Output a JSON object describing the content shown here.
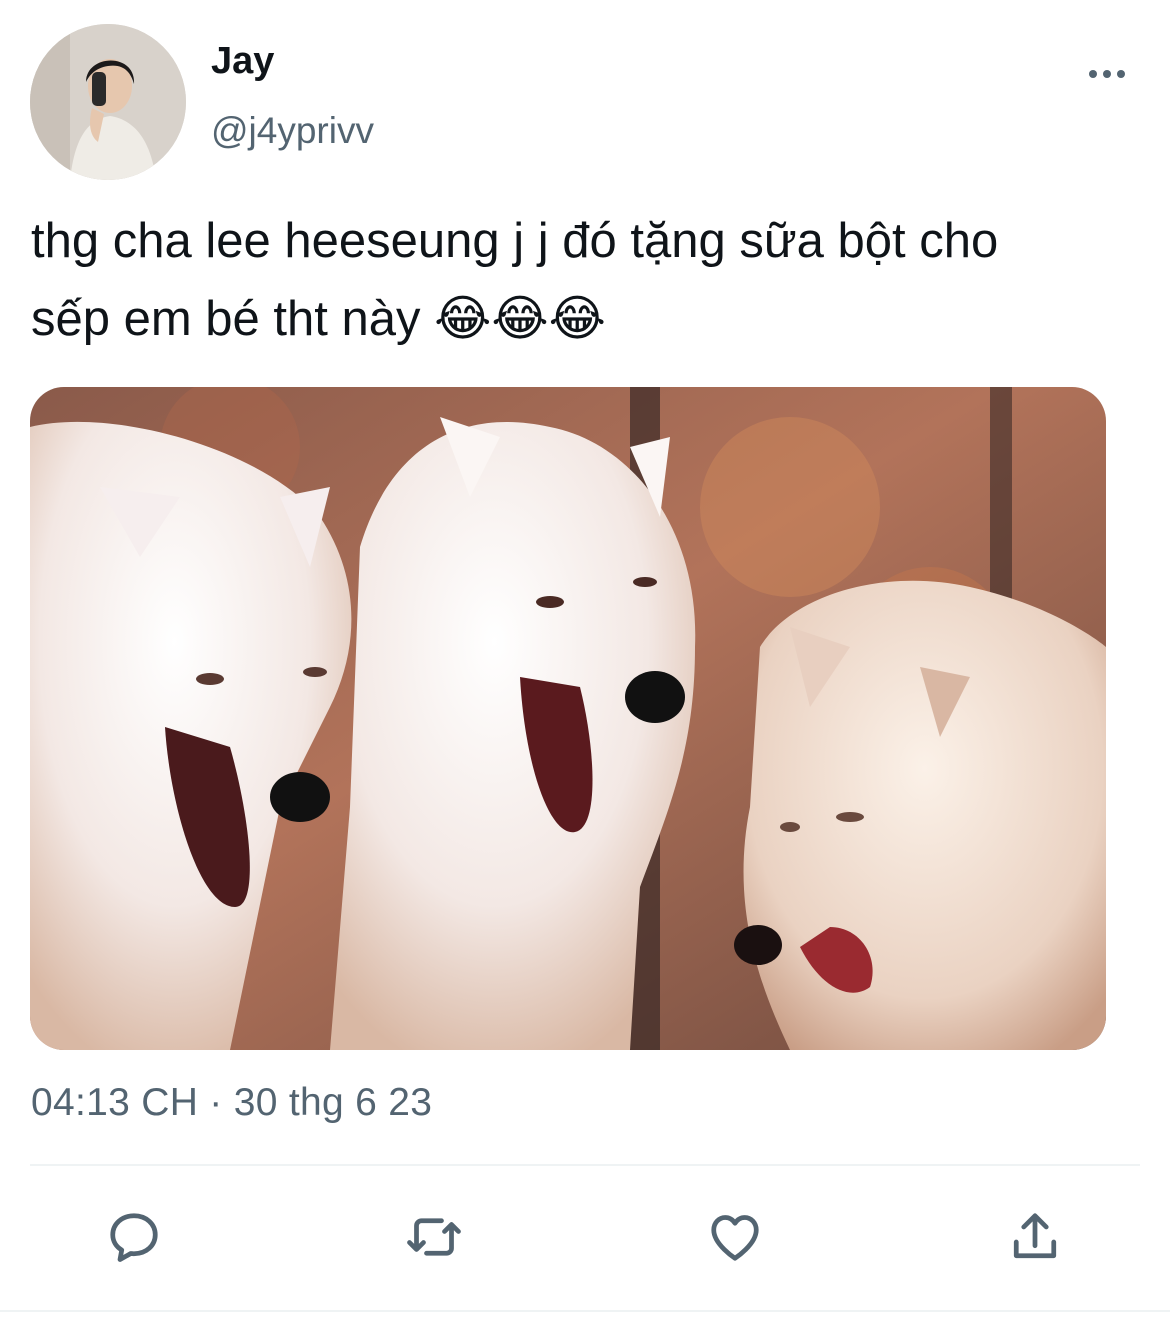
{
  "tweet": {
    "author": {
      "display_name": "Jay",
      "handle": "@j4yprivv",
      "avatar_icon": "avatar-photo"
    },
    "text_line1": "thg cha lee heeseung j j đó tặng sữa bột cho",
    "text_line2": "sếp em bé tht này 😂😂😂",
    "timestamp": "04:13 CH · 30 thg 6 23",
    "media": {
      "icon": "photo-three-laughing-white-wolves"
    }
  },
  "actions": [
    {
      "name": "reply",
      "icon": "reply-icon"
    },
    {
      "name": "retweet",
      "icon": "retweet-icon"
    },
    {
      "name": "like",
      "icon": "heart-icon"
    },
    {
      "name": "share",
      "icon": "share-icon"
    }
  ],
  "colors": {
    "text": "#0f1419",
    "secondary": "#536471",
    "divider": "#eff3f4"
  }
}
